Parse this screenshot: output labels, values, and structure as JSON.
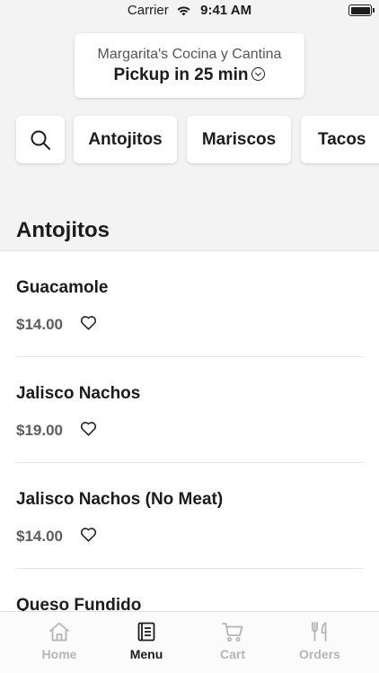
{
  "status_bar": {
    "carrier": "Carrier",
    "time": "9:41 AM"
  },
  "header": {
    "restaurant_name": "Margarita's Cocina y Cantina",
    "pickup_label": "Pickup in 25 min"
  },
  "categories": [
    "Antojitos",
    "Mariscos",
    "Tacos"
  ],
  "section": {
    "title": "Antojitos"
  },
  "menu_items": [
    {
      "name": "Guacamole",
      "price": "$14.00"
    },
    {
      "name": "Jalisco Nachos",
      "price": "$19.00"
    },
    {
      "name": "Jalisco Nachos (No Meat)",
      "price": "$14.00"
    },
    {
      "name": "Queso Fundido",
      "price": ""
    }
  ],
  "tabs": [
    {
      "label": "Home",
      "icon": "home-icon",
      "active": false
    },
    {
      "label": "Menu",
      "icon": "menu-book-icon",
      "active": true
    },
    {
      "label": "Cart",
      "icon": "cart-icon",
      "active": false
    },
    {
      "label": "Orders",
      "icon": "fork-knife-icon",
      "active": false
    }
  ],
  "colors": {
    "text": "#1c1c1e",
    "price": "#5d5d5d",
    "inactive_tab": "#b5b5b5",
    "background": "#f3f3f3"
  }
}
